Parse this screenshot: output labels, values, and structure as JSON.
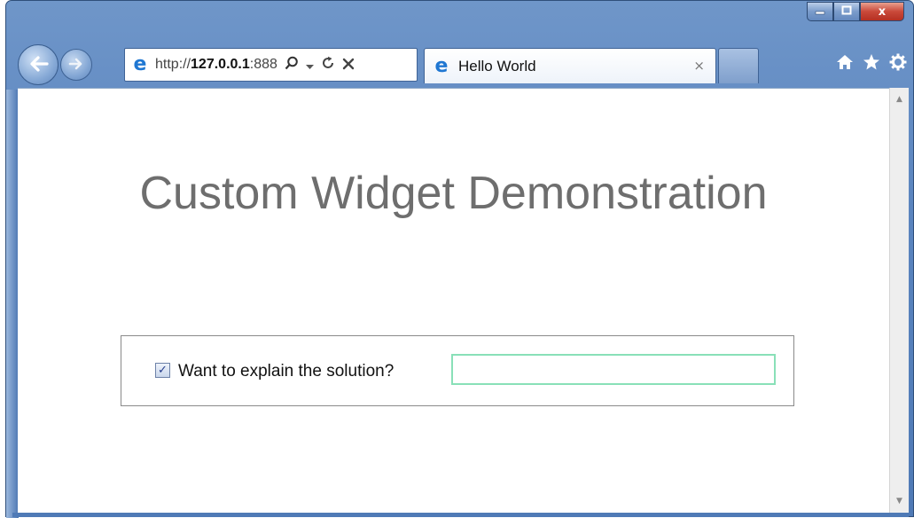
{
  "window": {
    "caption_buttons": {
      "minimize_icon": "minimize-icon",
      "maximize_icon": "maximize-icon",
      "close_icon": "close-icon",
      "close_glyph": "x"
    }
  },
  "navigation": {
    "back_icon": "back-arrow-icon",
    "forward_icon": "forward-arrow-icon"
  },
  "address_bar": {
    "url_prefix": "http://",
    "url_host": "127.0.0.1",
    "url_port": ":888",
    "search_icon": "search-icon",
    "dropdown_icon": "dropdown-icon",
    "refresh_icon": "refresh-icon",
    "stop_icon": "stop-icon"
  },
  "tab": {
    "title": "Hello World",
    "close_glyph": "×"
  },
  "toolbar": {
    "home_icon": "home-icon",
    "favorites_icon": "star-icon",
    "tools_icon": "gear-icon"
  },
  "page": {
    "heading": "Custom Widget Demonstration",
    "checkbox": {
      "label": "Want to explain the solution?",
      "checked": true
    },
    "text_input": {
      "value": ""
    }
  },
  "colors": {
    "heading": "#6e6e6e",
    "input_border": "#89e0b8",
    "frame": "#5b85bf",
    "close_button": "#c9493a"
  }
}
